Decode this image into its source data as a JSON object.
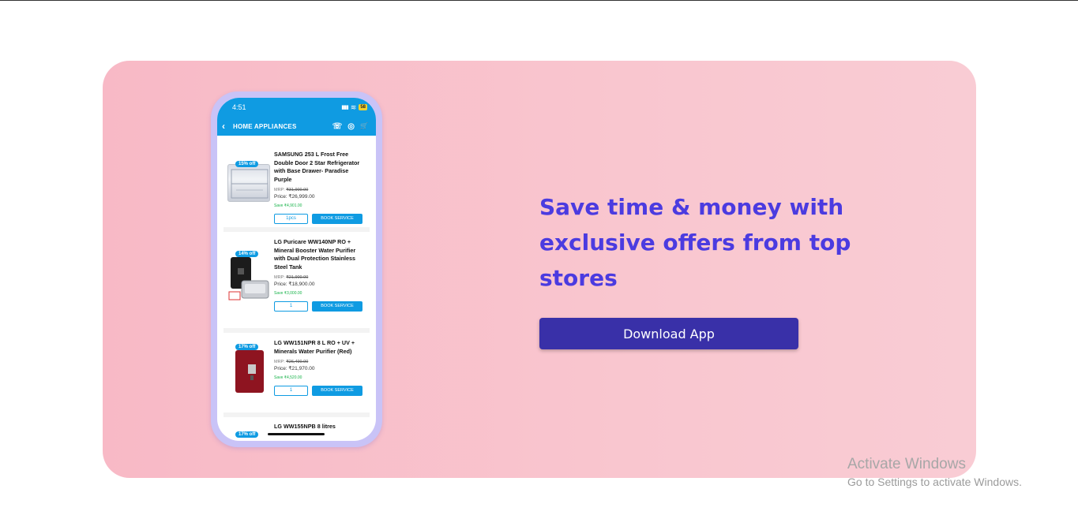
{
  "headline": "Save time & money with exclusive offers from top stores",
  "download_button": "Download App",
  "phone": {
    "time": "4:51",
    "signal": "▮▮▮",
    "wifi": "≋",
    "battery": "58",
    "back": "‹",
    "title": "HOME APPLIANCES",
    "call_icon": "☏",
    "whatsapp_icon": "◎",
    "cart_icon": "🛒",
    "products": [
      {
        "badge": "15% off",
        "name": "SAMSUNG 253 L Frost Free Double Door 2 Star Refrigerator with Base Drawer- Paradise Purple",
        "mrp_label": "MRP",
        "mrp": "₹31,900.00",
        "price": "Price: ₹26,999.00",
        "save": "Save ₹4,901.00",
        "qty": "1pcs",
        "action": "BOOK SERVICE"
      },
      {
        "badge": "14% off",
        "name": "LG Puricare WW140NP RO + Mineral Booster Water Purifier with Dual Protection Stainless Steel Tank",
        "mrp_label": "MRP",
        "mrp": "₹21,900.00",
        "price": "Price: ₹18,900.00",
        "save": "Save ₹3,000.00",
        "qty": "1",
        "action": "BOOK SERVICE"
      },
      {
        "badge": "17% off",
        "name": "LG WW151NPR 8 L RO + UV + Minerals Water Purifier (Red)",
        "mrp_label": "MRP",
        "mrp": "₹26,490.00",
        "price": "Price: ₹21,970.00",
        "save": "Save ₹4,520.00",
        "qty": "1",
        "action": "BOOK SERVICE"
      },
      {
        "badge": "17% off",
        "name": "LG WW155NPB 8 litres"
      }
    ]
  },
  "watermark": {
    "line1": "Activate Windows",
    "line2": "Go to Settings to activate Windows."
  }
}
